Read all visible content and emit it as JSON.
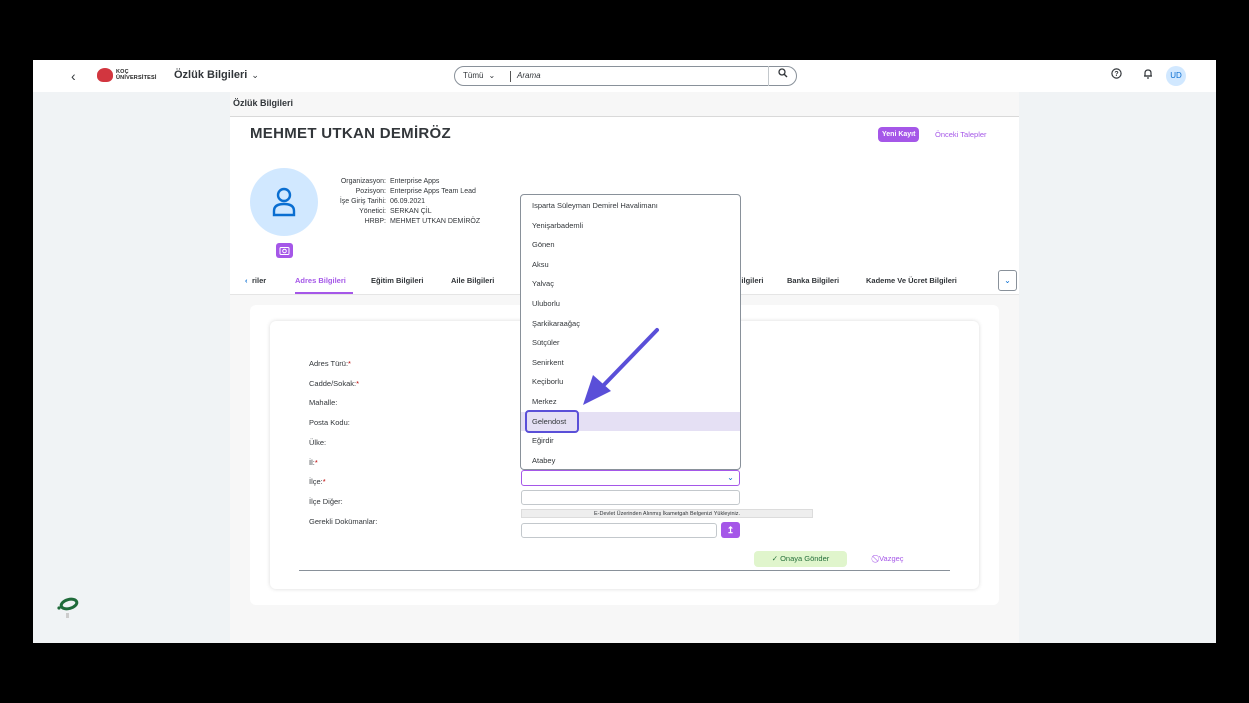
{
  "shell": {
    "back_icon": "chevron-left-icon",
    "logo_text_line1": "KOÇ",
    "logo_text_line2": "ÜNİVERSİTESİ",
    "app_title": "Özlük Bilgileri",
    "search_category": "Tümü",
    "search_placeholder": "Arama",
    "avatar_initials": "UD"
  },
  "page": {
    "title": "Özlük Bilgileri",
    "person_name": "MEHMET UTKAN DEMİRÖZ",
    "new_record_label": "Yeni Kayıt",
    "previous_requests_label": "Önceki Talepler",
    "info": [
      {
        "label": "Organizasyon:",
        "value": "Enterprise Apps"
      },
      {
        "label": "Pozisyon:",
        "value": "Enterprise Apps Team Lead"
      },
      {
        "label": "İşe Giriş Tarihi:",
        "value": "06.09.2021"
      },
      {
        "label": "Yönetici:",
        "value": "SERKAN ÇİL"
      },
      {
        "label": "HRBP:",
        "value": "MEHMET UTKAN DEMİRÖZ"
      }
    ]
  },
  "tabs": [
    "riler",
    "Adres Bilgileri",
    "Eğitim Bilgileri",
    "Aile Bilgileri",
    "Bilgileri",
    "Banka Bilgileri",
    "Kademe Ve Ücret Bilgileri"
  ],
  "form": {
    "labels": {
      "address_type": "Adres Türü:",
      "street": "Cadde/Sokak:",
      "neighborhood": "Mahalle:",
      "postal_code": "Posta Kodu:",
      "country": "Ülke:",
      "province": "İl:",
      "district": "İlçe:",
      "district_other": "İlçe Diğer:",
      "required_docs": "Gerekli Dokümanlar:"
    },
    "required_mark": "*",
    "doc_note": "E-Devlet Üzerinden Alınmış İkametgah Belgenizi Yükleyiniz.",
    "send_label": "Onaya Gönder",
    "cancel_label": "Vazgeç"
  },
  "dropdown": {
    "options": [
      "Isparta Süleyman Demirel Havalimanı",
      "Yenişarbademli",
      "Gönen",
      "Aksu",
      "Yalvaç",
      "Uluborlu",
      "Şarkikaraağaç",
      "Sütçüler",
      "Senirkent",
      "Keçiborlu",
      "Merkez",
      "Gelendost",
      "Eğirdir",
      "Atabey"
    ],
    "highlighted": "Gelendost"
  },
  "colors": {
    "accent": "#a557e8",
    "annotation": "#5a4fd8"
  }
}
